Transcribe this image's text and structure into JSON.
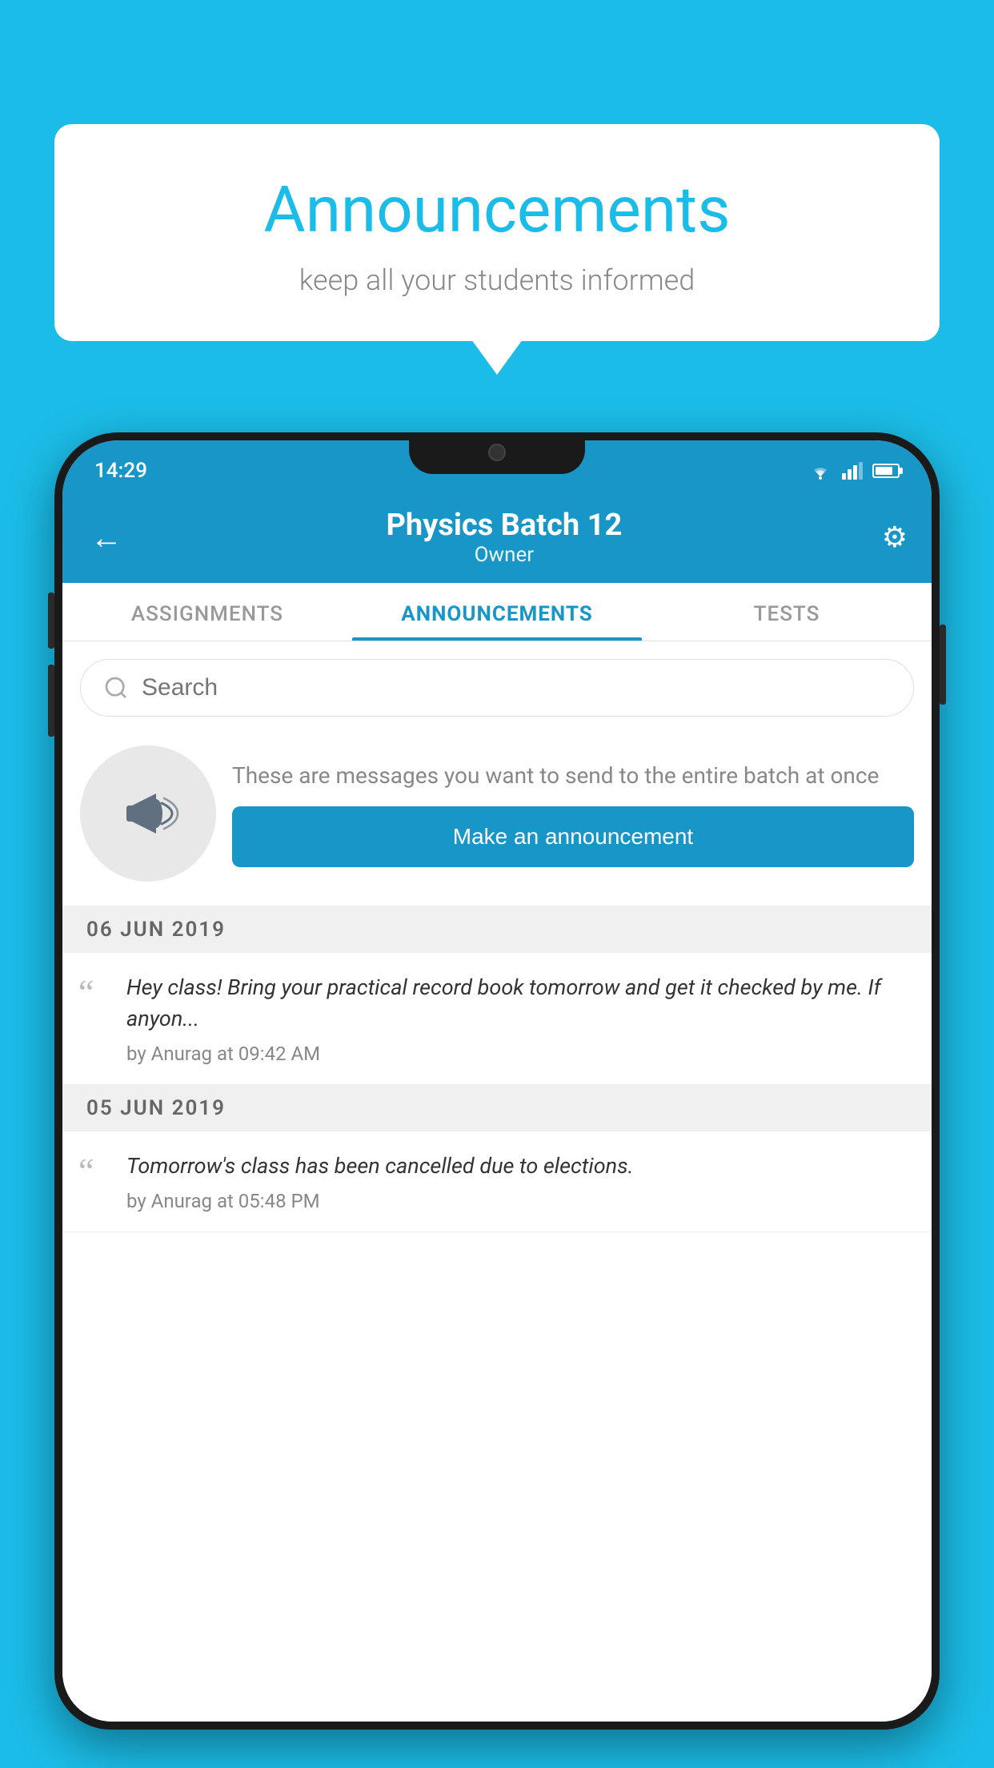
{
  "background_color": "#1BBDE8",
  "speech_bubble": {
    "title": "Announcements",
    "subtitle": "keep all your students informed"
  },
  "phone": {
    "status_bar": {
      "time": "14:29"
    },
    "header": {
      "title": "Physics Batch 12",
      "subtitle": "Owner",
      "back_label": "←",
      "settings_label": "⚙"
    },
    "tabs": [
      {
        "label": "ASSIGNMENTS",
        "active": false
      },
      {
        "label": "ANNOUNCEMENTS",
        "active": true
      },
      {
        "label": "TESTS",
        "active": false
      }
    ],
    "search": {
      "placeholder": "Search"
    },
    "promo": {
      "description": "These are messages you want to send to the entire batch at once",
      "button_label": "Make an announcement"
    },
    "announcements": [
      {
        "date": "06  JUN  2019",
        "text": "Hey class! Bring your practical record book tomorrow and get it checked by me. If anyon...",
        "meta": "by Anurag at 09:42 AM"
      },
      {
        "date": "05  JUN  2019",
        "text": "Tomorrow's class has been cancelled due to elections.",
        "meta": "by Anurag at 05:48 PM"
      }
    ]
  }
}
